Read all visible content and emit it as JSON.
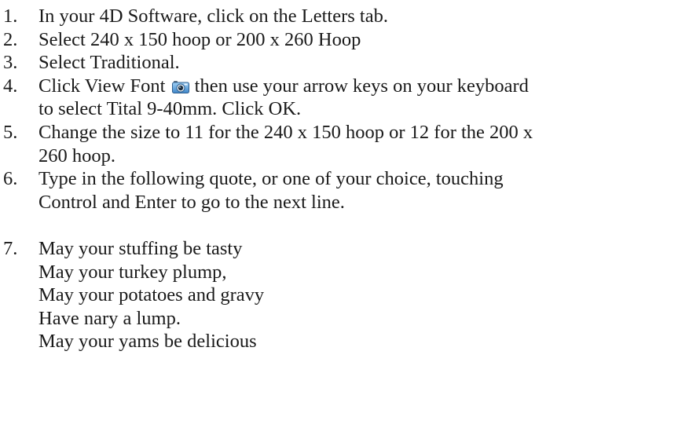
{
  "instructions": [
    {
      "num": "1.",
      "lines": [
        "In your 4D Software, click on the Letters tab."
      ]
    },
    {
      "num": "2.",
      "lines": [
        "Select 240 x 150 hoop or 200 x 260 Hoop"
      ]
    },
    {
      "num": "3.",
      "lines": [
        "Select Traditional."
      ]
    },
    {
      "num": "4.",
      "text_before_icon": "Click View Font",
      "icon": "camera-icon",
      "text_after_icon": "then use your arrow keys on your keyboard",
      "lines": [
        "to select Tital 9-40mm. Click OK."
      ]
    },
    {
      "num": "5.",
      "lines": [
        "Change the size to 11 for the 240 x 150 hoop or 12 for the 200 x",
        "260 hoop."
      ]
    },
    {
      "num": "6.",
      "lines": [
        "Type in the following quote, or one of your choice, touching",
        "Control and Enter to go to the next line."
      ]
    },
    {
      "num": "7.",
      "lines": [
        "May your stuffing be tasty",
        "May your turkey plump,",
        "May your potatoes and gravy",
        "Have nary a lump.",
        "May your yams be delicious"
      ]
    }
  ]
}
